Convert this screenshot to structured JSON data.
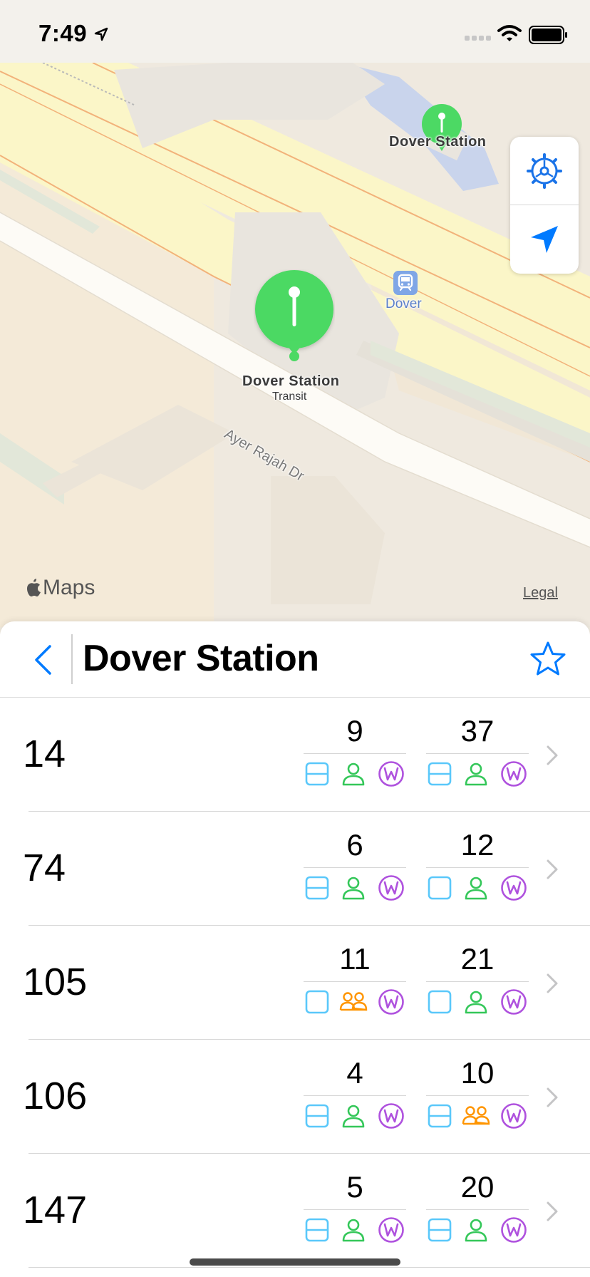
{
  "status_bar": {
    "time": "7:49"
  },
  "map": {
    "labels": {
      "top_station": "Dover Station",
      "main_station": "Dover Station",
      "main_station_sub": "Transit",
      "mrt": "Dover",
      "road": "Ayer Rajah Dr"
    },
    "attribution": "Maps",
    "legal": "Legal",
    "colors": {
      "pin": "#4cd964",
      "road_edge": "#f2b27a",
      "yellow_road": "#fbf6c8",
      "rail": "#c7d3ee"
    }
  },
  "sheet": {
    "title": "Dover Station",
    "favorite": false
  },
  "legend_colors": {
    "seats": "#5ac8fa",
    "standing": "#34c759",
    "limited": "#ff9500",
    "wheelchair": "#af52de",
    "accent": "#007aff"
  },
  "services": [
    {
      "number": "14",
      "next": {
        "mins": "9",
        "deck": "double",
        "load": "seats"
      },
      "subsequent": {
        "mins": "37",
        "deck": "double",
        "load": "seats"
      }
    },
    {
      "number": "74",
      "next": {
        "mins": "6",
        "deck": "double",
        "load": "seats"
      },
      "subsequent": {
        "mins": "12",
        "deck": "single",
        "load": "seats"
      }
    },
    {
      "number": "105",
      "next": {
        "mins": "11",
        "deck": "single",
        "load": "standing"
      },
      "subsequent": {
        "mins": "21",
        "deck": "single",
        "load": "seats"
      }
    },
    {
      "number": "106",
      "next": {
        "mins": "4",
        "deck": "double",
        "load": "seats"
      },
      "subsequent": {
        "mins": "10",
        "deck": "double",
        "load": "standing"
      }
    },
    {
      "number": "147",
      "next": {
        "mins": "5",
        "deck": "double",
        "load": "seats"
      },
      "subsequent": {
        "mins": "20",
        "deck": "double",
        "load": "seats"
      }
    }
  ]
}
